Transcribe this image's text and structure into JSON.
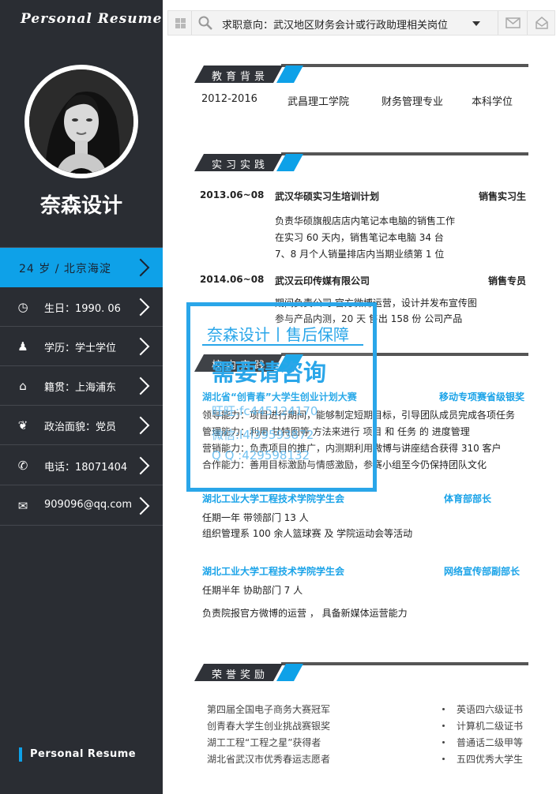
{
  "brand": "Personal  Resume",
  "name": "奈森设计",
  "highlight": "24 岁  /  北京海淀",
  "sidebar": [
    {
      "icon": "clock-icon",
      "glyph": "◷",
      "label": "生日：1990. 06"
    },
    {
      "icon": "user-icon",
      "glyph": "♟",
      "label": "学历：学士学位"
    },
    {
      "icon": "home-icon",
      "glyph": "⌂",
      "label": "籍贯：上海浦东"
    },
    {
      "icon": "leaf-icon",
      "glyph": "❦",
      "label": "政治面貌：党员"
    },
    {
      "icon": "phone-icon",
      "glyph": "✆",
      "label": "电话：18071404"
    },
    {
      "icon": "mail-icon",
      "glyph": "✉",
      "label": "909096@qq.com"
    }
  ],
  "footer": "Personal  Resume",
  "topbar": {
    "text": "求职意向：武汉地区财务会计或行政助理相关岗位"
  },
  "sections": {
    "education": "教育背景",
    "practice": "实习实践",
    "campus": "校内实践",
    "honors": "荣誉奖励"
  },
  "education": {
    "years": "2012-2016",
    "school": "武昌理工学院",
    "major": "财务管理专业",
    "degree": "本科学位"
  },
  "internships": [
    {
      "date": "2013.06~08",
      "company": "武汉华硕实习生培训计划",
      "role": "销售实习生",
      "lines": [
        "负责华硕旗舰店店内笔记本电脑的销售工作",
        "在实习 60 天内，销售笔记本电脑 34 台",
        "7、8 月个人销量排店内当期业绩第 1 位"
      ]
    },
    {
      "date": "2014.06~08",
      "company": "武汉云印传媒有限公司",
      "role": "销售专员",
      "lines": [
        "期间负责公司  官方微博运营，设计并发布宣传图",
        "参与产品内测，20 天  售出  158 份  公司产品"
      ]
    }
  ],
  "campus": [
    {
      "org": "湖北省“创青春”大学生创业计划大赛",
      "role": "移动专项赛省级银奖",
      "lines": [
        "领导能力：项目进行期间，能够制定短期目标，引导团队成员完成各项任务",
        "管理能力：利用   甘特图等   方法来进行  项目  和  任务  的  进度管理",
        "营销能力：负责项目的推广，内测期利用微博与讲座结合获得 310 客户",
        "合作能力：善用目标激励与情感激励，参赛小组至今仍保持团队文化"
      ]
    },
    {
      "org": "湖北工业大学工程技术学院学生会",
      "role": "体育部部长",
      "lines": [
        "任期一年        带领部门 13 人",
        "组织管理系 100 余人篮球赛      及      学院运动会等活动"
      ]
    },
    {
      "org": "湖北工业大学工程技术学院学生会",
      "role": "网络宣传部副部长",
      "lines": [
        "任期半年        协助部门 7 人",
        "负责院报官方微博的运营       ，     具备新媒体运营能力"
      ]
    }
  ],
  "honors_left": [
    "第四届全国电子商务大赛冠军",
    "创青春大学生创业挑战赛银奖",
    "湖工工程“工程之星”获得者",
    "湖北省武汉市优秀春运志愿者"
  ],
  "honors_right": [
    "英语四六级证书",
    "计算机二级证书",
    "普通话二级甲等",
    "五四优秀大学生"
  ],
  "watermark": {
    "title": "奈森设计丨售后保障",
    "main": "需要请咨询",
    "wangwang": "旺旺:fc445124170",
    "weixin": "微信:l4l39593872",
    "qq": "Q Q :429598132"
  },
  "colors": {
    "sidebar": "#2a2d33",
    "accent": "#0ea1e8"
  }
}
